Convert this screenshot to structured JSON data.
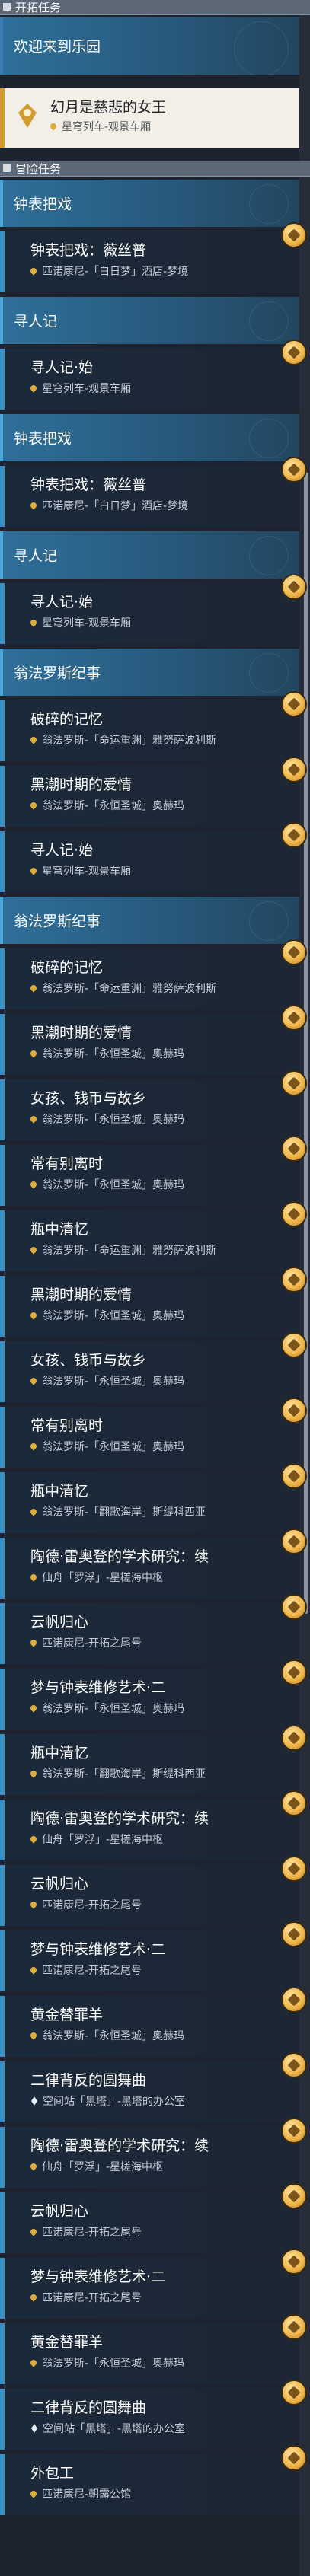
{
  "sections": {
    "opening": "开拓任务",
    "adventure": "冒险任务"
  },
  "opening_quests": [
    {
      "title": "欢迎来到乐园"
    },
    {
      "title": "幻月是慈悲的女王",
      "location": "星穹列车-观景车厢",
      "selected": true
    }
  ],
  "blocks": [
    {
      "type": "header",
      "text": "钟表把戏"
    },
    {
      "type": "quest",
      "title": "钟表把戏：薇丝普",
      "location": "匹诺康尼-「白日梦」酒店-梦境"
    },
    {
      "type": "header",
      "text": "寻人记"
    },
    {
      "type": "quest",
      "title": "寻人记·始",
      "location": "星穹列车-观景车厢"
    },
    {
      "type": "header",
      "text": "钟表把戏"
    },
    {
      "type": "quest",
      "title": "钟表把戏：薇丝普",
      "location": "匹诺康尼-「白日梦」酒店-梦境"
    },
    {
      "type": "header",
      "text": "寻人记"
    },
    {
      "type": "quest",
      "title": "寻人记·始",
      "location": "星穹列车-观景车厢"
    },
    {
      "type": "header",
      "text": "翁法罗斯纪事"
    },
    {
      "type": "quest",
      "title": "破碎的记忆",
      "location": "翁法罗斯-「命运重渊」雅努萨波利斯"
    },
    {
      "type": "quest",
      "title": "黑潮时期的爱情",
      "location": "翁法罗斯-「永恒圣城」奥赫玛"
    },
    {
      "type": "quest",
      "title": "寻人记·始",
      "location": "星穹列车-观景车厢"
    },
    {
      "type": "header",
      "text": "翁法罗斯纪事"
    },
    {
      "type": "quest",
      "title": "破碎的记忆",
      "location": "翁法罗斯-「命运重渊」雅努萨波利斯"
    },
    {
      "type": "quest",
      "title": "黑潮时期的爱情",
      "location": "翁法罗斯-「永恒圣城」奥赫玛"
    },
    {
      "type": "quest",
      "title": "女孩、钱币与故乡",
      "location": "翁法罗斯-「永恒圣城」奥赫玛"
    },
    {
      "type": "quest",
      "title": "常有别离时",
      "location": "翁法罗斯-「永恒圣城」奥赫玛"
    },
    {
      "type": "quest",
      "title": "瓶中清忆",
      "location": "翁法罗斯-「命运重渊」雅努萨波利斯"
    },
    {
      "type": "quest",
      "title": "黑潮时期的爱情",
      "location": "翁法罗斯-「永恒圣城」奥赫玛"
    },
    {
      "type": "quest",
      "title": "女孩、钱币与故乡",
      "location": "翁法罗斯-「永恒圣城」奥赫玛"
    },
    {
      "type": "quest",
      "title": "常有别离时",
      "location": "翁法罗斯-「永恒圣城」奥赫玛"
    },
    {
      "type": "quest",
      "title": "瓶中清忆",
      "location": "翁法罗斯-「翻歌海岸」斯缇科西亚"
    },
    {
      "type": "quest",
      "title": "陶德·雷奥登的学术研究：续",
      "location": "仙舟「罗浮」-星槎海中枢"
    },
    {
      "type": "quest",
      "title": "云帆归心",
      "location": "匹诺康尼-开拓之尾号"
    },
    {
      "type": "quest",
      "title": "梦与钟表维修艺术·二",
      "location": "翁法罗斯-「永恒圣城」奥赫玛"
    },
    {
      "type": "quest",
      "title": "瓶中清忆",
      "location": "翁法罗斯-「翻歌海岸」斯缇科西亚"
    },
    {
      "type": "quest",
      "title": "陶德·雷奥登的学术研究：续",
      "location": "仙舟「罗浮」-星槎海中枢"
    },
    {
      "type": "quest",
      "title": "云帆归心",
      "location": "匹诺康尼-开拓之尾号"
    },
    {
      "type": "quest",
      "title": "梦与钟表维修艺术·二",
      "location": "匹诺康尼-开拓之尾号"
    },
    {
      "type": "quest",
      "title": "黄金替罪羊",
      "location": "翁法罗斯-「永恒圣城」奥赫玛"
    },
    {
      "type": "quest",
      "title": "二律背反的圆舞曲",
      "location": "空间站「黑塔」-黑塔的办公室",
      "spire": true
    },
    {
      "type": "quest",
      "title": "陶德·雷奥登的学术研究：续",
      "location": "仙舟「罗浮」-星槎海中枢"
    },
    {
      "type": "quest",
      "title": "云帆归心",
      "location": "匹诺康尼-开拓之尾号"
    },
    {
      "type": "quest",
      "title": "梦与钟表维修艺术·二",
      "location": "匹诺康尼-开拓之尾号"
    },
    {
      "type": "quest",
      "title": "黄金替罪羊",
      "location": "翁法罗斯-「永恒圣城」奥赫玛"
    },
    {
      "type": "quest",
      "title": "二律背反的圆舞曲",
      "location": "空间站「黑塔」-黑塔的办公室",
      "spire": true
    },
    {
      "type": "quest",
      "title": "外包工",
      "location": "匹诺康尼-朝露公馆"
    }
  ]
}
